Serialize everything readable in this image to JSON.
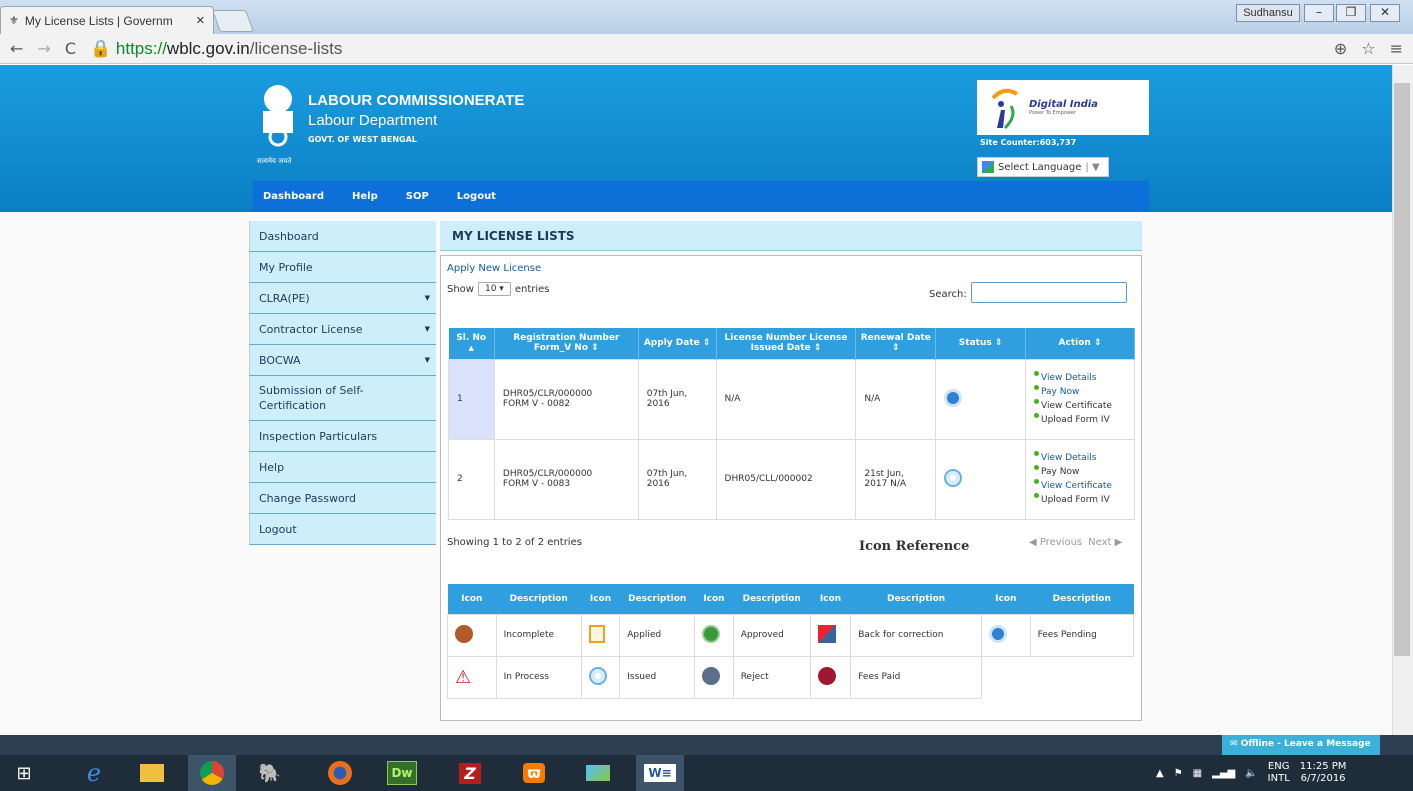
{
  "browser": {
    "tab_title": "My License Lists | Governm",
    "url_scheme": "https://",
    "url_domain": "wblc.gov.in",
    "url_path": "/license-lists",
    "profile_name": "Sudhansu"
  },
  "header": {
    "org_title": "LABOUR COMMISSIONERATE",
    "dept": "Labour Department",
    "govt": "GOVT. OF WEST BENGAL",
    "motto": "सत्यमेव जयते",
    "digital_india": "Digital India",
    "digital_tagline": "Power To Empower",
    "site_counter": "Site Counter:603,737",
    "select_language": "Select Language"
  },
  "topnav": [
    "Dashboard",
    "Help",
    "SOP",
    "Logout"
  ],
  "sidebar": [
    {
      "label": "Dashboard",
      "submenu": false
    },
    {
      "label": "My Profile",
      "submenu": false
    },
    {
      "label": "CLRA(PE)",
      "submenu": true
    },
    {
      "label": "Contractor License",
      "submenu": true
    },
    {
      "label": "BOCWA",
      "submenu": true
    },
    {
      "label": "Submission of Self-Certification",
      "submenu": false
    },
    {
      "label": "Inspection Particulars",
      "submenu": false
    },
    {
      "label": "Help",
      "submenu": false
    },
    {
      "label": "Change Password",
      "submenu": false
    },
    {
      "label": "Logout",
      "submenu": false
    }
  ],
  "main": {
    "title": "MY LICENSE LISTS",
    "apply_link": "Apply New License",
    "show_label": "Show",
    "entries_value": "10",
    "entries_label": "entries",
    "search_label": "Search:",
    "showing": "Showing 1 to 2 of 2 entries",
    "icon_reference": "Icon Reference",
    "previous": "Previous",
    "next": "Next"
  },
  "license_table": {
    "headers": [
      "Sl. No",
      "Registration Number Form_V No",
      "Apply Date",
      "License Number License Issued Date",
      "Renewal Date",
      "Status",
      "Action"
    ],
    "rows": [
      {
        "sl": "1",
        "reg": "DHR05/CLR/000000",
        "form": "FORM V - 0082",
        "apply": "07th Jun, 2016",
        "license": "N/A",
        "renewal": "N/A",
        "status_icon": "fees-pending-icon",
        "actions": [
          "View Details",
          "Pay Now",
          "View Certificate",
          "Upload Form IV"
        ]
      },
      {
        "sl": "2",
        "reg": "DHR05/CLR/000000",
        "form": "FORM V - 0083",
        "apply": "07th Jun, 2016",
        "license": "DHR05/CLL/000002",
        "renewal": "21st Jun, 2017 N/A",
        "status_icon": "issued-icon",
        "actions": [
          "View Details",
          "Pay Now",
          "View Certificate",
          "Upload Form IV"
        ]
      }
    ]
  },
  "icon_table": {
    "headers": [
      "Icon",
      "Description",
      "Icon",
      "Description",
      "Icon",
      "Description",
      "Icon",
      "Description",
      "Icon",
      "Description"
    ],
    "row1": [
      "Incomplete",
      "Applied",
      "Approved",
      "Back for correction",
      "Fees Pending"
    ],
    "row2": [
      "In Process",
      "Issued",
      "Reject",
      "Fees Paid"
    ]
  },
  "chat": {
    "label": "Offline - Leave a Message"
  },
  "tray": {
    "lang1": "ENG",
    "lang2": "INTL",
    "time": "11:25 PM",
    "date": "6/7/2016"
  },
  "colors": {
    "header_blue": "#0b7ec3",
    "nav_blue": "#0d6fd8",
    "table_head": "#2f9fe0",
    "sidebar_bg": "#cdeffa"
  }
}
